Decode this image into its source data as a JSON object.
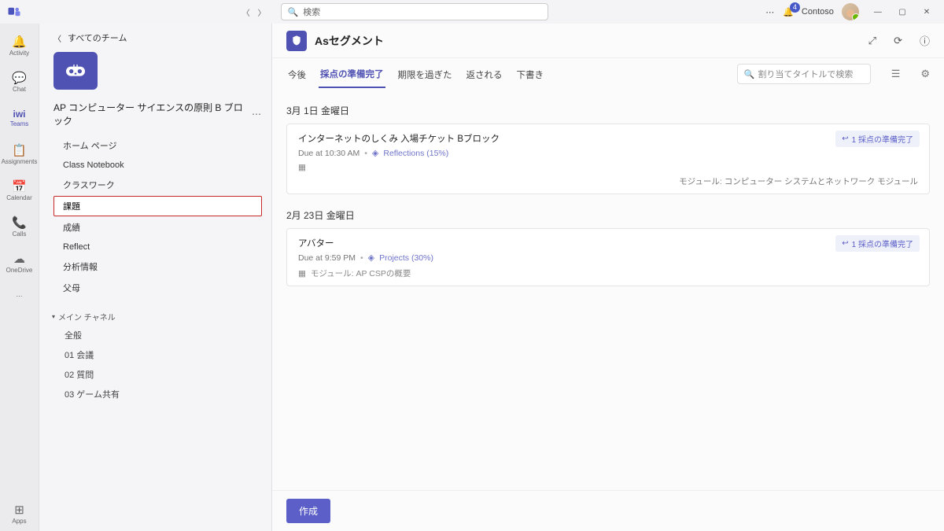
{
  "titlebar": {
    "search_placeholder": "検索",
    "notification_count": "4",
    "org_name": "Contoso"
  },
  "rail": [
    {
      "icon": "🔔",
      "label": "Activity"
    },
    {
      "icon": "💬",
      "label": "Chat"
    },
    {
      "icon": "iwi",
      "label": "Teams",
      "active": true,
      "textIcon": true
    },
    {
      "icon": "📋",
      "label": "Assignments"
    },
    {
      "icon": "📅",
      "label": "Calendar"
    },
    {
      "icon": "📞",
      "label": "Calls"
    },
    {
      "icon": "☁",
      "label": "OneDrive"
    }
  ],
  "rail_bottom": {
    "icon": "⊞",
    "label": "Apps"
  },
  "sidebar": {
    "back_label": "すべてのチーム",
    "team_name": "AP コンピューター サイエンスの原則 B ブロック",
    "nav": [
      {
        "label": "ホーム ページ"
      },
      {
        "label": "Class Notebook"
      },
      {
        "label": "クラスワーク"
      },
      {
        "label": "課題",
        "active": true
      },
      {
        "label": "成績"
      },
      {
        "label": "Reflect"
      },
      {
        "label": "分析情報"
      },
      {
        "label": "父母"
      }
    ],
    "channel_section": "メイン チャネル",
    "channels": [
      {
        "label": "全般"
      },
      {
        "label": "01 会議"
      },
      {
        "label": "02 質問"
      },
      {
        "label": "03 ゲーム共有"
      }
    ]
  },
  "header": {
    "title": "Asセグメント"
  },
  "tabs": [
    {
      "label": "今後"
    },
    {
      "label": "採点の準備完了",
      "active": true
    },
    {
      "label": "期限を過ぎた"
    },
    {
      "label": "返される"
    },
    {
      "label": "下書き"
    }
  ],
  "assignment_search_placeholder": "割り当てタイトルで検索",
  "groups": [
    {
      "date": "3月 1日 金曜日",
      "items": [
        {
          "title": "インターネットのしくみ 入場チケット Bブロック",
          "due": "Due at 10:30 AM",
          "tag": "Reflections (15%)",
          "status": "1 採点の準備完了",
          "module": "モジュール: コンピューター システムとネットワーク モジュール",
          "module_right": true
        }
      ]
    },
    {
      "date": "2月 23日 金曜日",
      "items": [
        {
          "title": "アバター",
          "due": "Due at 9:59 PM",
          "tag": "Projects (30%)",
          "status": "1 採点の準備完了",
          "module": "モジュール: AP CSPの概要",
          "module_right": false
        }
      ]
    }
  ],
  "create_label": "作成"
}
